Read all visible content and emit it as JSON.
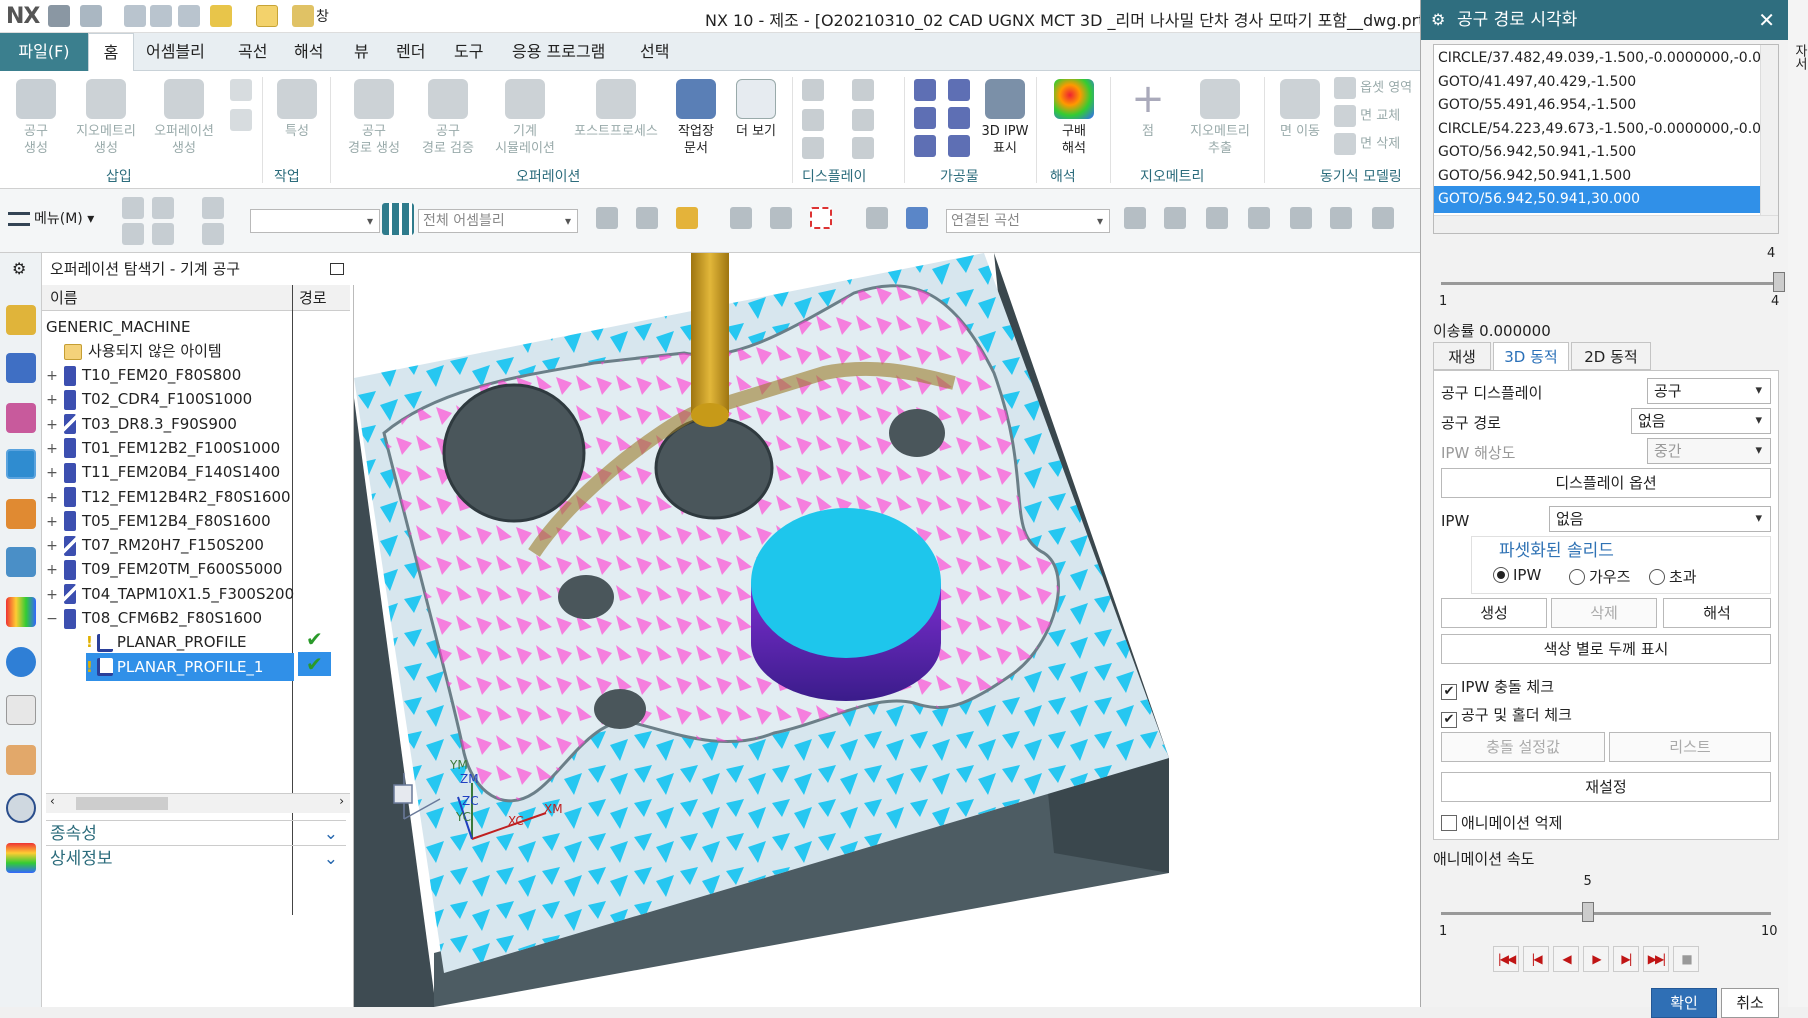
{
  "app": {
    "logo": "NX",
    "window_title": "NX 10 - 제조 - [O20210310_02 CAD UGNX MCT 3D _리머 나사밀 단차 경사 모따기 포함__dwg.prt (수정됨)]",
    "window_menu_label": "창",
    "right_edge_text": "자서"
  },
  "ribbon_tabs": {
    "file": "파일(F)",
    "tabs": [
      "홈",
      "어셈블리",
      "곡선",
      "해석",
      "뷰",
      "렌더",
      "도구",
      "응용 프로그램",
      "선택"
    ]
  },
  "ribbon": {
    "insert": {
      "buttons": [
        "공구\n생성",
        "지오메트리\n생성",
        "오퍼레이션\n생성"
      ],
      "group": "삽입"
    },
    "work": {
      "buttons": [
        "특성"
      ],
      "group": "작업"
    },
    "operation": {
      "buttons": [
        "공구\n경로 생성",
        "공구\n경로 검증",
        "기계\n시뮬레이션",
        "포스트프로세스",
        "작업장\n문서",
        "더 보기"
      ],
      "group": "오퍼레이션"
    },
    "display": {
      "group": "디스플레이"
    },
    "workpiece": {
      "buttons": [
        "3D IPW\n표시"
      ],
      "group": "가공물"
    },
    "analysis": {
      "buttons": [
        "구배\n해석"
      ],
      "group": "해석"
    },
    "geometry": {
      "buttons": [
        "점",
        "지오메트리\n추출"
      ],
      "group": "지오메트리"
    },
    "sync": {
      "buttons": [
        "면 이동",
        "옵셋 영역",
        "면 교체",
        "면 삭제"
      ],
      "group": "동기식 모델링"
    }
  },
  "toolbar": {
    "menu_label": "메뉴(M)",
    "filter_value": "",
    "scope_value": "전체 어셈블리",
    "curve_rule_value": "연결된 곡선"
  },
  "navigator": {
    "title": "오퍼레이션 탐색기 - 기계 공구",
    "col_name": "이름",
    "col_path": "경로",
    "root": "GENERIC_MACHINE",
    "unused": "사용되지 않은 아이템",
    "tools": [
      {
        "name": "T10_FEM20_F80S800",
        "expand": "+",
        "drill": false
      },
      {
        "name": "T02_CDR4_F100S1000",
        "expand": "+",
        "drill": false
      },
      {
        "name": "T03_DR8.3_F90S900",
        "expand": "+",
        "drill": true
      },
      {
        "name": "T01_FEM12B2_F100S1000",
        "expand": "+",
        "drill": false
      },
      {
        "name": "T11_FEM20B4_F140S1400",
        "expand": "+",
        "drill": false
      },
      {
        "name": "T12_FEM12B4R2_F80S1600",
        "expand": "+",
        "drill": false
      },
      {
        "name": "T05_FEM12B4_F80S1600",
        "expand": "+",
        "drill": false
      },
      {
        "name": "T07_RM20H7_F150S200",
        "expand": "+",
        "drill": true
      },
      {
        "name": "T09_FEM20TM_F600S5000",
        "expand": "+",
        "drill": false
      },
      {
        "name": "T04_TAPM10X1.5_F300S200",
        "expand": "+",
        "drill": true
      },
      {
        "name": "T08_CFM6B2_F80S1600",
        "expand": "−",
        "drill": false
      }
    ],
    "operations": [
      {
        "name": "PLANAR_PROFILE",
        "selected": false,
        "path_ok": "✔"
      },
      {
        "name": "PLANAR_PROFILE_1",
        "selected": true,
        "path_ok": "✔"
      }
    ],
    "sections": [
      "종속성",
      "상세정보"
    ]
  },
  "viewport": {
    "axis_labels": [
      "YM",
      "ZM",
      "ZC",
      "YC",
      "XC",
      "XM"
    ],
    "colors": {
      "part_top": "#d7e6ee",
      "part_side": "#4d5c63",
      "gouge_magenta": "#ff3fd2",
      "excess_cyan": "#13c3f2",
      "boss": "#1ec6ec",
      "tool": "#c79a18"
    }
  },
  "dialog": {
    "title": "공구 경로 시각화",
    "path_lines": [
      "CIRCLE/37.482,49.039,-1.500,-0.0000000,-0.0000000",
      "GOTO/41.497,40.429,-1.500",
      "GOTO/55.491,46.954,-1.500",
      "CIRCLE/54.223,49.673,-1.500,-0.0000000,-0.0000000",
      "GOTO/56.942,50.941,-1.500",
      "GOTO/56.942,50.941,1.500",
      "GOTO/56.942,50.941,30.000"
    ],
    "selected_line": 6,
    "step_slider": {
      "min": "1",
      "max": "4",
      "value": "4",
      "fraction": 1.0
    },
    "feed_label": "이송률 0.000000",
    "tabs": [
      "재생",
      "3D 동적",
      "2D 동적"
    ],
    "active_tab": 1,
    "tool_display_label": "공구 디스플레이",
    "tool_display_value": "공구",
    "tool_path_label": "공구 경로",
    "tool_path_value": "없음",
    "ipw_res_label": "IPW 해상도",
    "ipw_res_value": "중간",
    "display_options_btn": "디스플레이 옵션",
    "ipw_label": "IPW",
    "ipw_value": "없음",
    "faceted_title": "파셋화된 솔리드",
    "radios": [
      {
        "label": "IPW",
        "on": true
      },
      {
        "label": "가우즈",
        "on": false
      },
      {
        "label": "초과",
        "on": false
      }
    ],
    "btn_create": "생성",
    "btn_delete": "삭제",
    "btn_analyze": "해석",
    "btn_thickness": "색상 별로 두께 표시",
    "chk_ipw_collision": "IPW 충돌 체크",
    "chk_tool_holder": "공구 및 홀더 체크",
    "btn_collision_settings": "충돌 설정값",
    "btn_list": "리스트",
    "btn_reset": "재설정",
    "chk_suppress_anim": "애니메이션 억제",
    "anim_speed_label": "애니메이션 속도",
    "speed_slider": {
      "min": "1",
      "max": "10",
      "value": "5",
      "fraction": 0.444
    },
    "ok": "확인",
    "cancel": "취소",
    "accent": "#2f6e7f"
  }
}
